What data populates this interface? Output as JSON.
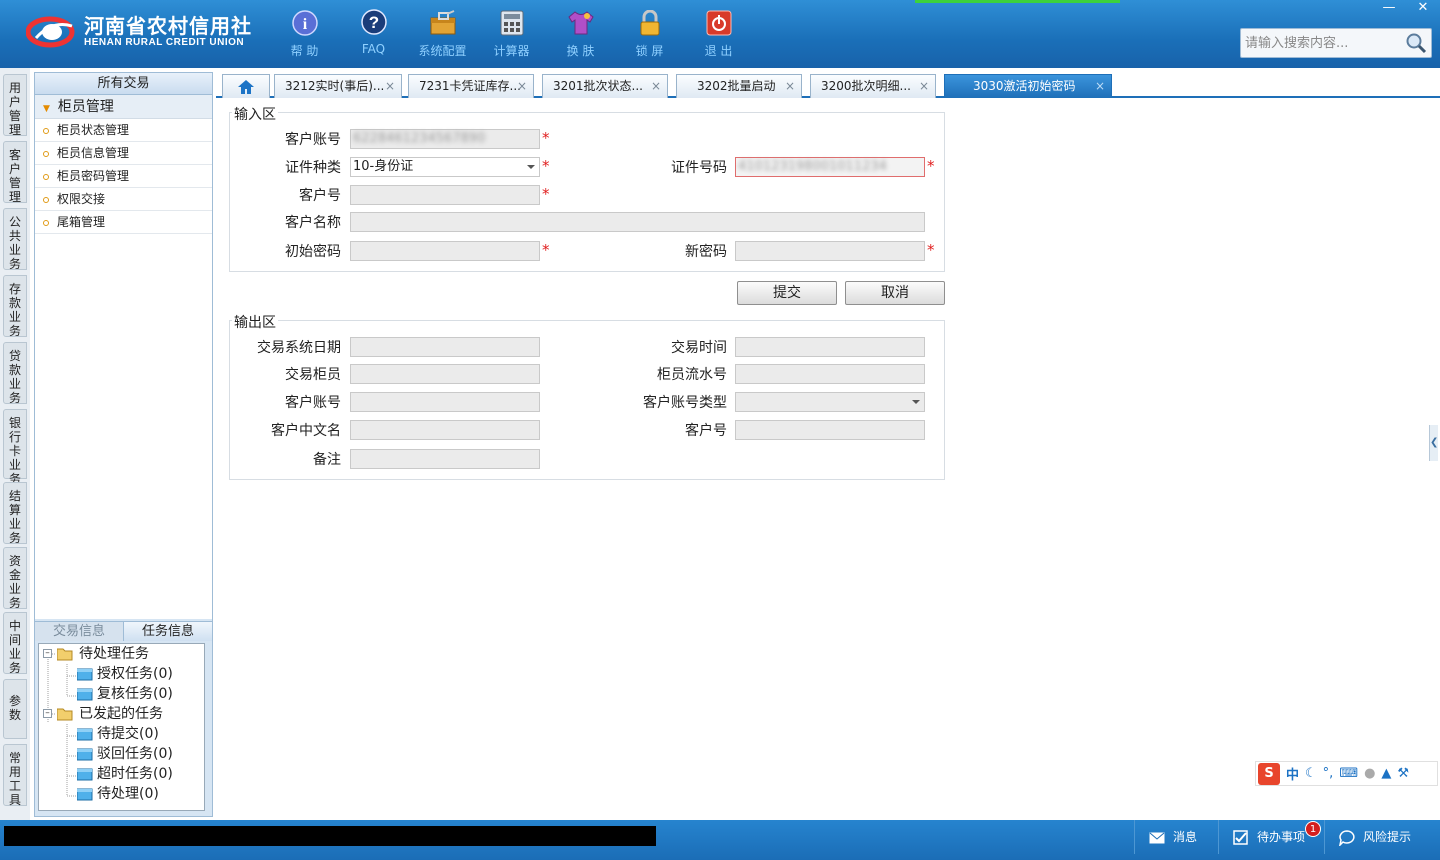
{
  "app": {
    "logo_cn": "河南省农村信用社",
    "logo_en": "HENAN RURAL CREDIT UNION"
  },
  "toolbar": [
    {
      "label": "帮 助",
      "icon": "info-icon"
    },
    {
      "label": "FAQ",
      "icon": "question-icon"
    },
    {
      "label": "系统配置",
      "icon": "toolbox-icon"
    },
    {
      "label": "计算器",
      "icon": "calculator-icon"
    },
    {
      "label": "换 肤",
      "icon": "shirt-icon"
    },
    {
      "label": "锁 屏",
      "icon": "lock-icon"
    },
    {
      "label": "退 出",
      "icon": "power-icon"
    }
  ],
  "search": {
    "placeholder": "请输入搜索内容..."
  },
  "vtabs": [
    "用户管理",
    "客户管理",
    "公共业务",
    "存款业务",
    "贷款业务",
    "银行卡业务",
    "结算业务",
    "资金业务",
    "中间业务",
    "参数",
    "常用工具"
  ],
  "nav": {
    "title": "所有交易",
    "group": "柜员管理",
    "items": [
      "柜员状态管理",
      "柜员信息管理",
      "柜员密码管理",
      "权限交接",
      "尾箱管理"
    ]
  },
  "task_tabs": {
    "tab1": "交易信息",
    "tab2": "任务信息"
  },
  "tree": {
    "pending": "待处理任务",
    "auth": "授权任务(0)",
    "review": "复核任务(0)",
    "initiated": "已发起的任务",
    "to_submit": "待提交(0)",
    "rejected": "驳回任务(0)",
    "timeout": "超时任务(0)",
    "processing": "待处理(0)"
  },
  "work_tabs": [
    "3212实时(事后)...",
    "7231卡凭证库存...",
    "3201批次状态...",
    "3202批量启动",
    "3200批次明细...",
    "3030激活初始密码"
  ],
  "input_section": {
    "title": "输入区",
    "account_label": "客户账号",
    "account_value": "6228461234567890",
    "id_type_label": "证件种类",
    "id_type_value": "10-身份证",
    "id_no_label": "证件号码",
    "id_no_value": "410123198001011234",
    "cust_no_label": "客户号",
    "cust_name_label": "客户名称",
    "init_pwd_label": "初始密码",
    "new_pwd_label": "新密码"
  },
  "buttons": {
    "submit": "提交",
    "cancel": "取消"
  },
  "output_section": {
    "title": "输出区",
    "sys_date_label": "交易系统日期",
    "txn_time_label": "交易时间",
    "teller_label": "交易柜员",
    "serial_label": "柜员流水号",
    "account_label": "客户账号",
    "account_type_label": "客户账号类型",
    "cn_name_label": "客户中文名",
    "cust_no_label": "客户号",
    "remark_label": "备注"
  },
  "ime": {
    "cn": "中"
  },
  "statusbar": {
    "msg": "消息",
    "todo": "待办事项",
    "todo_count": "1",
    "risk": "风险提示"
  },
  "colors": {
    "accent": "#1e6fb8",
    "required": "#e02020"
  }
}
